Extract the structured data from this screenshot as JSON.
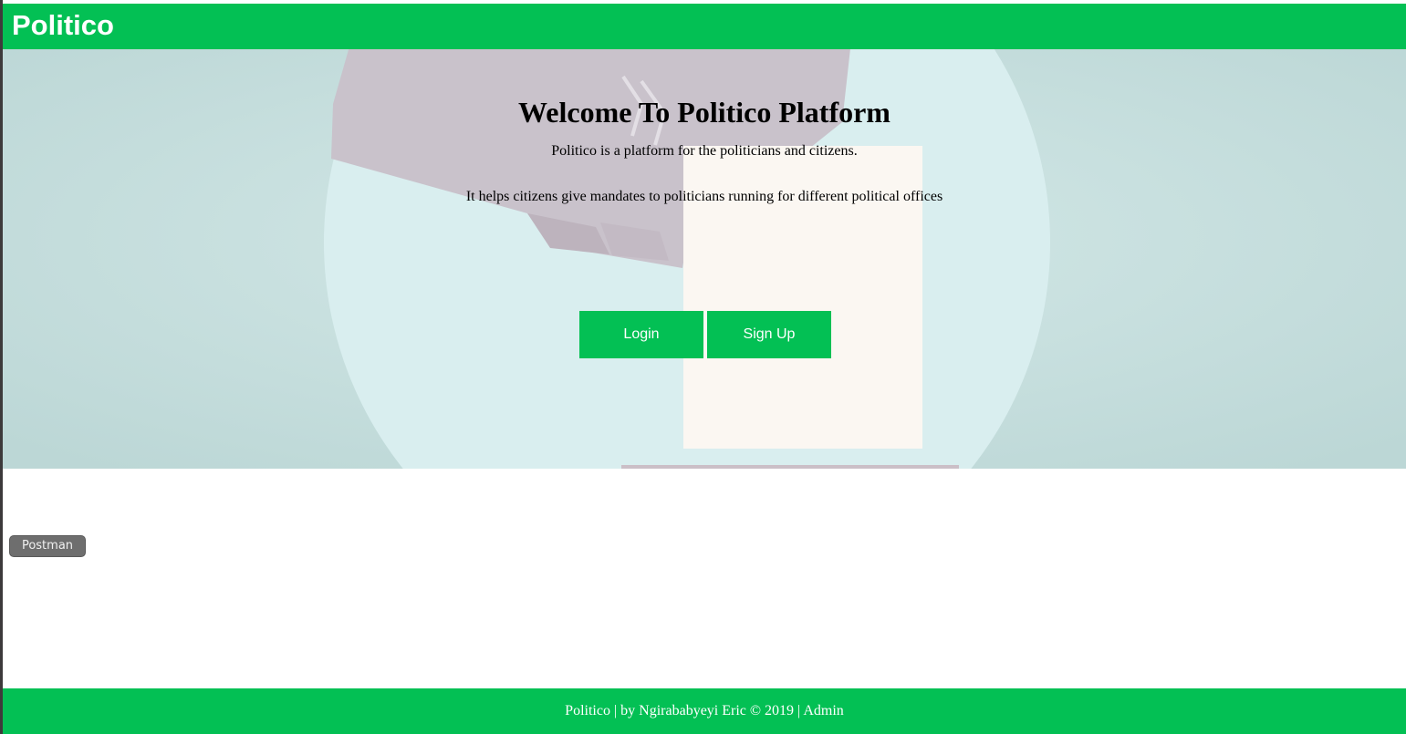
{
  "header": {
    "brand": "Politico"
  },
  "hero": {
    "title": "Welcome To Politico Platform",
    "description_line1": "Politico is a platform for the politicians and citizens.",
    "description_line2": "It helps citizens give mandates to politicians running for different political offices",
    "buttons": {
      "login_label": "Login",
      "signup_label": "Sign Up"
    },
    "background_icon": "ballot-hand-illustration"
  },
  "overlay": {
    "postman_label": "Postman"
  },
  "footer": {
    "text": "Politico | by Ngirababyeyi Eric © 2019 | Admin"
  },
  "colors": {
    "brand_green": "#03c054",
    "hero_bg": "#c4dedd",
    "badge_gray": "#6e6e6e"
  }
}
